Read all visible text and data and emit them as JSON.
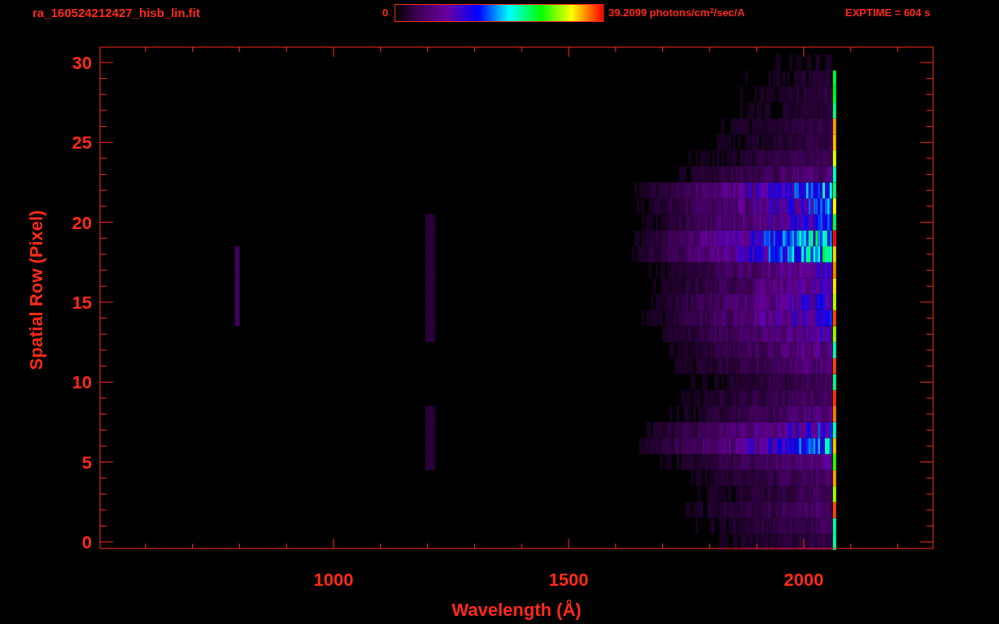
{
  "header": {
    "filename": "ra_160524212427_hisb_lin.fit",
    "colorbar": {
      "min_label": "0",
      "max_label": "39.2099 photons/cm$^{2}$/sec/A"
    },
    "exposure": "EXPTIME = 604 s"
  },
  "plot": {
    "xlabel": "Wavelength (Å)",
    "ylabel": "Spatial Row (Pixel)",
    "xticks": [
      "1000",
      "1500",
      "2000"
    ],
    "yticks": [
      "30",
      "25",
      "20",
      "15",
      "10",
      "5",
      "0"
    ]
  }
}
